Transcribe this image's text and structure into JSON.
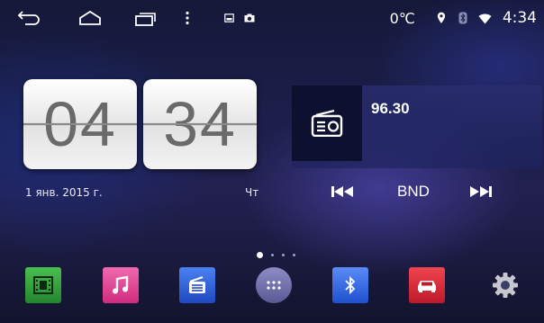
{
  "status_bar": {
    "temperature": "0℃",
    "time": "4:34",
    "icons": [
      "back-icon",
      "home-icon",
      "recent-apps-icon",
      "overflow-menu-icon",
      "screenshot-icon",
      "camera-icon",
      "location-icon",
      "bluetooth-icon",
      "wifi-icon"
    ]
  },
  "clock_widget": {
    "hours": "04",
    "minutes": "34",
    "date": "1 янв. 2015 г.",
    "weekday": "Чт"
  },
  "radio_widget": {
    "frequency": "96.30",
    "band_label": "BND",
    "icons": [
      "radio-icon",
      "previous-icon",
      "next-icon"
    ]
  },
  "page_indicator": {
    "pages": 4,
    "current": 1
  },
  "dock": {
    "apps": [
      {
        "name": "video-app-icon",
        "color": "#2e9a3a"
      },
      {
        "name": "music-app-icon",
        "color": "#e0418f"
      },
      {
        "name": "radio-app-icon",
        "color": "#2f5fd6"
      },
      {
        "name": "app-drawer-icon",
        "color": "#6b6aa8"
      },
      {
        "name": "bluetooth-app-icon",
        "color": "#2d63e0"
      },
      {
        "name": "car-app-icon",
        "color": "#d9283a"
      },
      {
        "name": "settings-app-icon",
        "color": "#b9b9c4"
      }
    ]
  }
}
